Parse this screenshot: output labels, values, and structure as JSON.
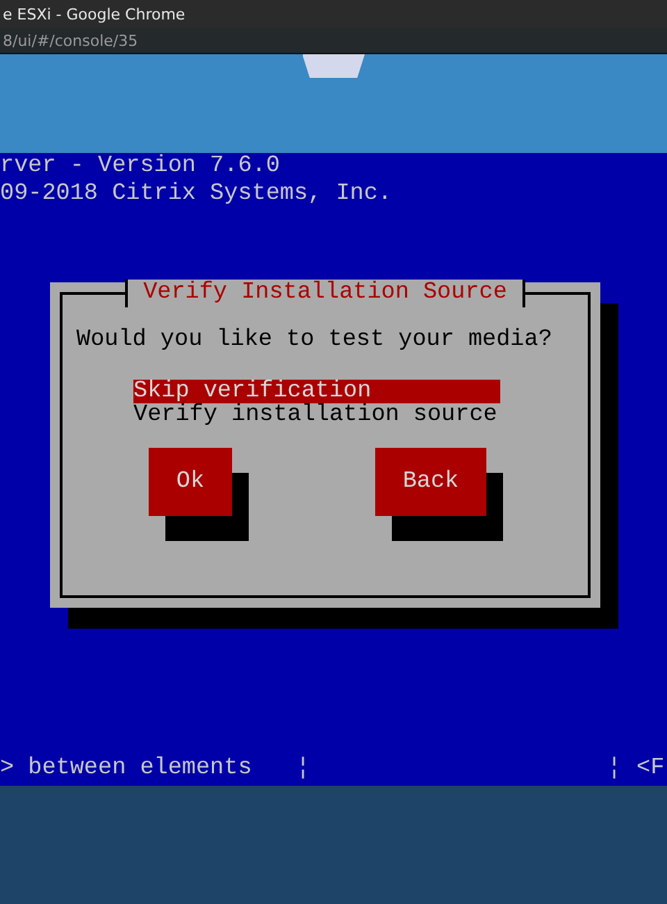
{
  "browser": {
    "title": "e ESXi - Google Chrome",
    "address": "8/ui/#/console/35"
  },
  "console": {
    "header_lines": [
      "rver - Version 7.6.0",
      "09-2018 Citrix Systems, Inc."
    ],
    "dialog": {
      "title": "Verify Installation Source",
      "question": "Would you like to test your media?",
      "options": [
        {
          "label": "Skip verification",
          "selected": true
        },
        {
          "label": "Verify installation source",
          "selected": false
        }
      ],
      "buttons": [
        "Ok",
        "Back"
      ]
    },
    "status_bar": [
      "> between elements",
      "¦",
      "¦",
      "<F"
    ]
  }
}
